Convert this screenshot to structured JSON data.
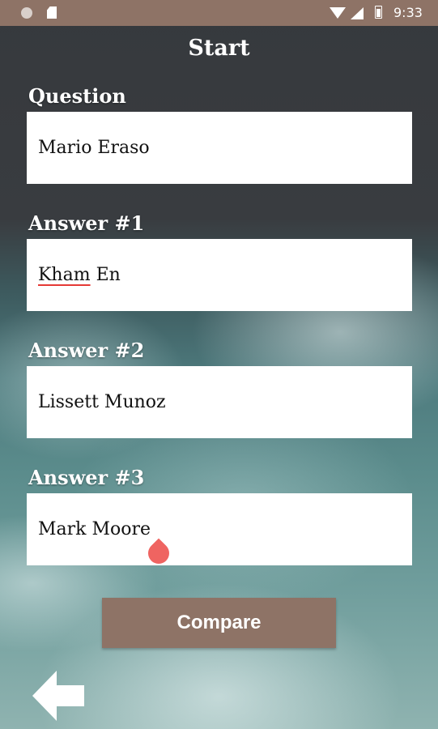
{
  "status_bar": {
    "time": "9:33",
    "icons": [
      "notification-circle-icon",
      "sd-card-icon",
      "wifi-icon",
      "signal-icon",
      "battery-icon"
    ]
  },
  "header": {
    "title": "Start"
  },
  "form": {
    "question_label": "Question",
    "question_value": "Mario Eraso",
    "answer1_label": "Answer #1",
    "answer1_value_word1": "Kham",
    "answer1_value_word2": " En",
    "answer2_label": "Answer #2",
    "answer2_value": "Lissett Munoz",
    "answer3_label": "Answer #3",
    "answer3_value": "Mark Moore"
  },
  "actions": {
    "compare_label": "Compare",
    "back_icon": "back-arrow-icon"
  },
  "colors": {
    "accent": "#8e7366",
    "cursor_handle": "#ef6461",
    "spellcheck_underline": "#e53935",
    "field_background": "#ffffff",
    "label_text": "#ffffff"
  }
}
